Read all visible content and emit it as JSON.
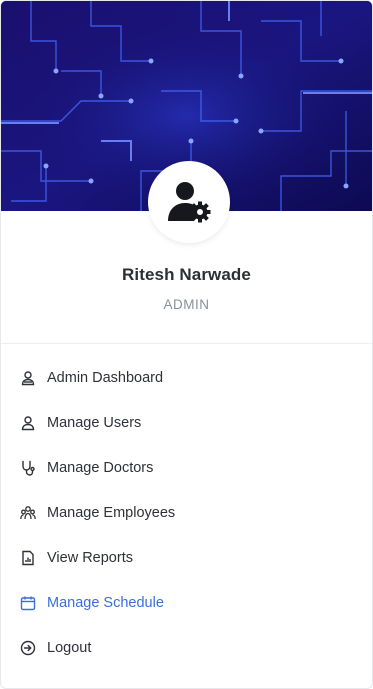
{
  "profile": {
    "name": "Ritesh Narwade",
    "role": "ADMIN",
    "avatar_icon": "user-gear-icon"
  },
  "menu": {
    "items": [
      {
        "label": "Admin Dashboard",
        "icon": "user-icon",
        "active": false
      },
      {
        "label": "Manage Users",
        "icon": "user-icon",
        "active": false
      },
      {
        "label": "Manage Doctors",
        "icon": "stethoscope-icon",
        "active": false
      },
      {
        "label": "Manage Employees",
        "icon": "users-group-icon",
        "active": false
      },
      {
        "label": "View Reports",
        "icon": "report-icon",
        "active": false
      },
      {
        "label": "Manage Schedule",
        "icon": "calendar-icon",
        "active": true
      },
      {
        "label": "Logout",
        "icon": "logout-icon",
        "active": false
      }
    ]
  },
  "colors": {
    "banner_dark": "#120a5c",
    "banner_glow": "#3a5cff",
    "active": "#3a6fd8",
    "text": "#2f3138",
    "muted": "#8a8f98"
  }
}
